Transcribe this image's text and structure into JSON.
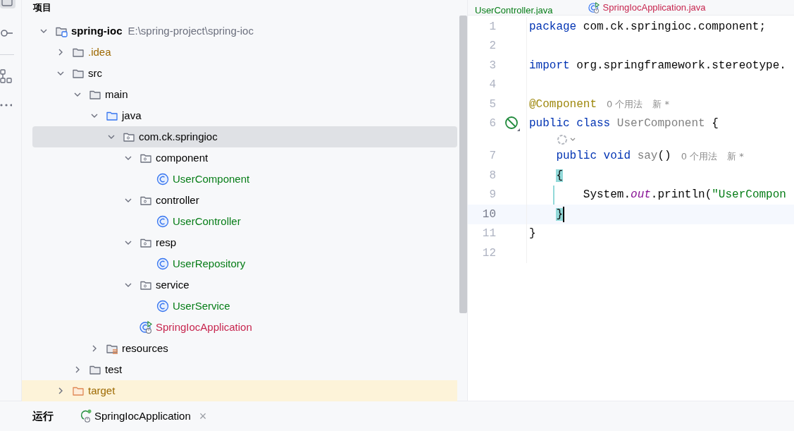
{
  "project_panel": {
    "title": "项目"
  },
  "tree": [
    {
      "label": "spring-ioc",
      "path": "E:\\spring-project\\spring-ioc",
      "kind": "module",
      "expanded": true,
      "selected": false,
      "color": "#000000",
      "children": [
        {
          "label": ".idea",
          "kind": "folder",
          "expanded": false,
          "selected": false,
          "color": "#9e6a03"
        },
        {
          "label": "src",
          "kind": "folder",
          "expanded": true,
          "selected": false,
          "color": "#000000",
          "children": [
            {
              "label": "main",
              "kind": "folder",
              "expanded": true,
              "selected": false,
              "color": "#000000",
              "children": [
                {
                  "label": "java",
                  "kind": "source-folder",
                  "expanded": true,
                  "selected": false,
                  "color": "#000000",
                  "children": [
                    {
                      "label": "com.ck.springioc",
                      "kind": "package",
                      "expanded": true,
                      "selected": true,
                      "color": "#000000",
                      "children": [
                        {
                          "label": "component",
                          "kind": "package",
                          "expanded": true,
                          "selected": false,
                          "color": "#000000",
                          "children": [
                            {
                              "label": "UserComponent",
                              "kind": "class",
                              "selected": false,
                              "color": "#067d17"
                            }
                          ]
                        },
                        {
                          "label": "controller",
                          "kind": "package",
                          "expanded": true,
                          "selected": false,
                          "color": "#000000",
                          "children": [
                            {
                              "label": "UserController",
                              "kind": "class",
                              "selected": false,
                              "color": "#067d17"
                            }
                          ]
                        },
                        {
                          "label": "resp",
                          "kind": "package",
                          "expanded": true,
                          "selected": false,
                          "color": "#000000",
                          "children": [
                            {
                              "label": "UserRepository",
                              "kind": "class",
                              "selected": false,
                              "color": "#067d17"
                            }
                          ]
                        },
                        {
                          "label": "service",
                          "kind": "package",
                          "expanded": true,
                          "selected": false,
                          "color": "#000000",
                          "children": [
                            {
                              "label": "UserService",
                              "kind": "class",
                              "selected": false,
                              "color": "#067d17"
                            }
                          ]
                        },
                        {
                          "label": "SpringIocApplication",
                          "kind": "app-class",
                          "selected": false,
                          "color": "#c7254e"
                        }
                      ]
                    }
                  ]
                },
                {
                  "label": "resources",
                  "kind": "resources-folder",
                  "expanded": false,
                  "selected": false,
                  "color": "#000000"
                }
              ]
            },
            {
              "label": "test",
              "kind": "folder",
              "expanded": false,
              "selected": false,
              "color": "#000000"
            }
          ]
        },
        {
          "label": "target",
          "kind": "excluded-folder",
          "expanded": false,
          "selected": false,
          "color": "#9e6a03"
        }
      ]
    }
  ],
  "editor_tabs": [
    {
      "label": "UserController.java",
      "color": "#067d17",
      "kind": "class"
    },
    {
      "label": "SpringIocApplication.java",
      "color": "#c7254e",
      "kind": "app-class"
    }
  ],
  "code_lines": [
    {
      "kind": "code",
      "number": "1",
      "current": false,
      "segments": [
        {
          "kind": "keyword",
          "text": "package"
        },
        {
          "kind": "plain",
          "text": " com.ck.springioc.component;"
        }
      ]
    },
    {
      "kind": "code",
      "number": "2",
      "current": false
    },
    {
      "kind": "code",
      "number": "3",
      "current": false,
      "segments": [
        {
          "kind": "keyword",
          "text": "import"
        },
        {
          "kind": "plain",
          "text": " org.springframework.stereotype."
        }
      ]
    },
    {
      "kind": "code",
      "number": "4",
      "current": false
    },
    {
      "kind": "code",
      "number": "5",
      "current": false,
      "segments": [
        {
          "kind": "annotation",
          "text": "@Component"
        },
        {
          "kind": "hint",
          "text": "0 个用法"
        },
        {
          "kind": "hint",
          "text": "新 *"
        }
      ]
    },
    {
      "kind": "marked-code",
      "number": "6",
      "current": false,
      "segments": [
        {
          "kind": "keyword",
          "text": "public class "
        },
        {
          "kind": "unused",
          "text": "UserComponent"
        },
        {
          "kind": "plain",
          "text": " {"
        }
      ]
    },
    {
      "kind": "inlay"
    },
    {
      "kind": "code",
      "number": "7",
      "current": false,
      "segments": [
        {
          "kind": "keyword",
          "text": "    public void "
        },
        {
          "kind": "unused",
          "text": "say"
        },
        {
          "kind": "plain",
          "text": "()"
        },
        {
          "kind": "hint",
          "text": "0 个用法"
        },
        {
          "kind": "hint",
          "text": "新 *"
        }
      ]
    },
    {
      "kind": "code",
      "number": "8",
      "current": false,
      "segments": [
        {
          "kind": "brace-match",
          "text": "    {"
        }
      ]
    },
    {
      "kind": "code",
      "number": "9",
      "current": false,
      "scope_line": true,
      "segments": [
        {
          "kind": "plain",
          "text": "        System."
        },
        {
          "kind": "field",
          "text": "out"
        },
        {
          "kind": "plain",
          "text": ".println("
        },
        {
          "kind": "string",
          "text": "\"UserCompon"
        }
      ]
    },
    {
      "kind": "code",
      "number": "10",
      "current": true,
      "caret": true,
      "segments": [
        {
          "kind": "brace-match",
          "text": "    }"
        }
      ]
    },
    {
      "kind": "code",
      "number": "11",
      "current": false,
      "segments": [
        {
          "kind": "plain",
          "text": "}"
        }
      ]
    },
    {
      "kind": "code",
      "number": "12",
      "current": false
    }
  ],
  "bottom_bar": {
    "title": "运行",
    "tabs": [
      {
        "label": "SpringIocApplication",
        "close": "×"
      }
    ]
  }
}
